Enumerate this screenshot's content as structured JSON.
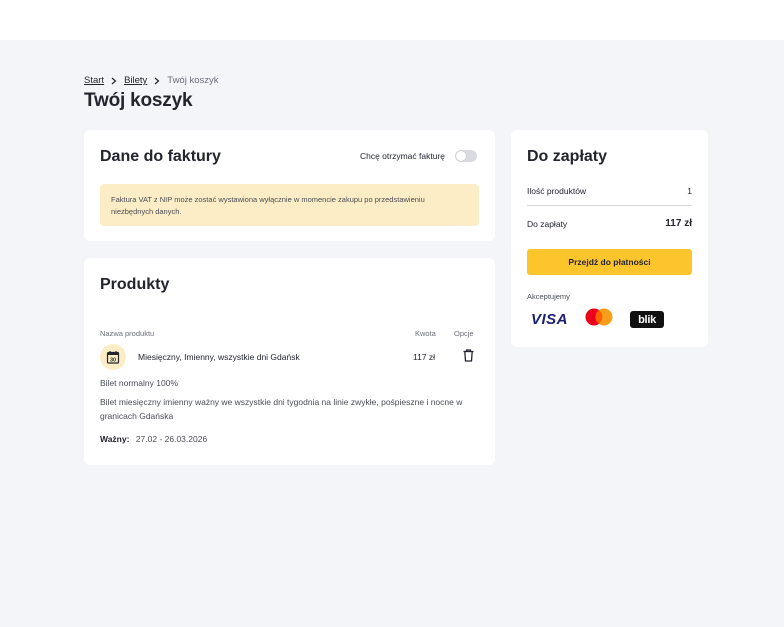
{
  "breadcrumb": {
    "start": "Start",
    "tickets": "Bilety",
    "current": "Twój koszyk"
  },
  "page": {
    "title": "Twój koszyk"
  },
  "invoice": {
    "title": "Dane do faktury",
    "toggle_label": "Chcę otrzymać fakturę",
    "toggle_on": false,
    "notice": "Faktura VAT z NIP może zostać wystawiona wyłącznie w momencie zakupu po przedstawieniu niezbędnych danych."
  },
  "products": {
    "title": "Produkty",
    "columns": {
      "name": "Nazwa produktu",
      "amount": "Kwota",
      "options": "Opcje"
    },
    "item": {
      "name": "Miesięczny, Imienny, wszystkie dni Gdańsk",
      "price": "117 zł",
      "icon": "calendar-icon",
      "icon_day": "30",
      "type": "Bilet normalny 100%",
      "description": "Bilet miesięczny imienny ważny we wszystkie dni tygodnia na linie zwykłe, pośpieszne i nocne w granicach Gdańska",
      "valid_label": "Ważny:",
      "valid_value": "27.02 - 26.03.2026"
    }
  },
  "summary": {
    "title": "Do zapłaty",
    "count_label": "Ilość produktów",
    "count_value": "1",
    "total_label": "Do zapłaty",
    "total_value": "117 zł",
    "pay_button": "Przejdź do płatności",
    "accept_label": "Akceptujemy",
    "visa_text": "VISA",
    "blik_text": "blik"
  },
  "colors": {
    "accent_yellow": "#fdc52c",
    "notice_bg": "#fdedc6",
    "page_bg": "#f4f5f9",
    "visa_blue": "#1a1f71"
  }
}
